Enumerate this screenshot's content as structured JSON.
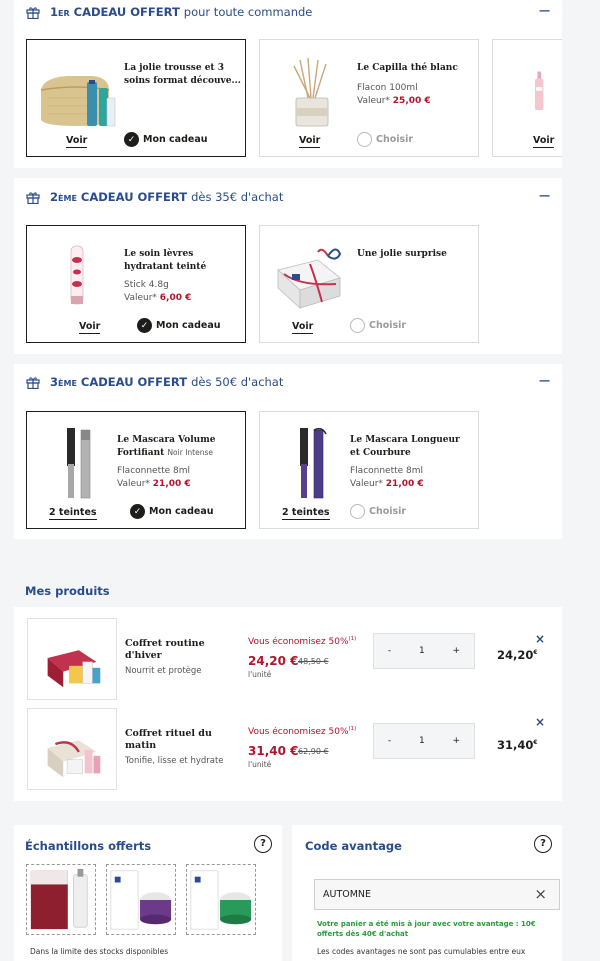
{
  "gift_sections": [
    {
      "rank_num": "1",
      "rank_suffix": "er",
      "title": "CADEAU OFFERT",
      "condition": "pour toute commande",
      "collapse_label": "−",
      "cards": [
        {
          "name": "La jolie trousse et 3 soins format découve...",
          "link": "Voir",
          "action": "Mon cadeau",
          "selected": true
        },
        {
          "name": "Le Capilla thé blanc",
          "desc": "Flacon 100ml",
          "value_label": "Valeur*",
          "price": "25,00 €",
          "link": "Voir",
          "action": "Choisir",
          "selected": false
        },
        {
          "link": "Voir"
        }
      ]
    },
    {
      "rank_num": "2",
      "rank_suffix": "ème",
      "title": "CADEAU OFFERT",
      "condition": "dès 35€ d'achat",
      "collapse_label": "−",
      "cards": [
        {
          "name": "Le soin lèvres hydratant teinté",
          "desc": "Stick 4.8g",
          "value_label": "Valeur*",
          "price": "6,00 €",
          "link": "Voir",
          "action": "Mon cadeau",
          "selected": true
        },
        {
          "name": "Une jolie surprise",
          "link": "Voir",
          "action": "Choisir",
          "selected": false
        }
      ]
    },
    {
      "rank_num": "3",
      "rank_suffix": "ème",
      "title": "CADEAU OFFERT",
      "condition": "dès 50€ d'achat",
      "collapse_label": "−",
      "cards": [
        {
          "name": "Le Mascara Volume Fortifiant",
          "name_sub": "Noir Intense",
          "desc": "Flaconnette 8ml",
          "value_label": "Valeur*",
          "price": "21,00 €",
          "link": "2 teintes",
          "action": "Mon cadeau",
          "selected": true
        },
        {
          "name": "Le Mascara Longueur et Courbure",
          "desc": "Flaconnette 8ml",
          "value_label": "Valeur*",
          "price": "21,00 €",
          "link": "2 teintes",
          "action": "Choisir",
          "selected": false
        }
      ]
    }
  ],
  "products": {
    "heading": "Mes produits",
    "items": [
      {
        "name": "Coffret routine d'hiver",
        "desc": "Nourrit et protège",
        "saving": "Vous économisez 50%",
        "saving_note": "(1)",
        "price": "24,20 €",
        "old_price": "48,50 €",
        "unit": "l'unité",
        "qty": "1",
        "minus": "-",
        "plus": "+",
        "total": "24,20",
        "total_currency": "€",
        "remove": "×"
      },
      {
        "name": "Coffret rituel du matin",
        "desc": "Tonifie, lisse et hydrate",
        "saving": "Vous économisez 50%",
        "saving_note": "(1)",
        "price": "31,40 €",
        "old_price": "62,90 €",
        "unit": "l'unité",
        "qty": "1",
        "minus": "-",
        "plus": "+",
        "total": "31,40",
        "total_currency": "€",
        "remove": "×"
      }
    ]
  },
  "samples": {
    "title": "Échantillons offerts",
    "help": "?",
    "limit_text": "Dans la limite des stocks disponibles"
  },
  "promo": {
    "title": "Code avantage",
    "help": "?",
    "code_value": "AUTOMNE",
    "clear_icon": "×",
    "success_msg": "Votre panier a été mis à jour avec votre avantage : 10€ offerts dès 40€ d'achat",
    "note": "Les codes avantages ne sont pas cumulables entre eux"
  },
  "colors": {
    "brand": "#2a4c8c",
    "price": "#b2142d",
    "success": "#2b9a3b",
    "background": "#f4f5f7"
  },
  "icons": [
    "gift-icon",
    "check-icon",
    "close-icon",
    "help-icon"
  ]
}
